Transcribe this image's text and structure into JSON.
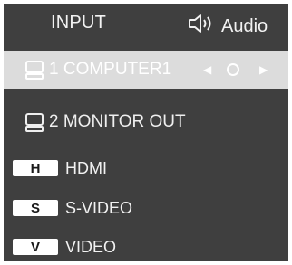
{
  "header": {
    "title": "INPUT",
    "audio_label": "Audio"
  },
  "inputs": [
    {
      "label": "1 COMPUTER1",
      "selected": true,
      "icon": "computer-icon"
    },
    {
      "label": "2 MONITOR OUT",
      "selected": false,
      "icon": "computer-icon"
    }
  ],
  "selector": {
    "left": "◀",
    "right": "▶"
  },
  "sources": [
    {
      "badge": "H",
      "label": "HDMI"
    },
    {
      "badge": "S",
      "label": "S-VIDEO"
    },
    {
      "badge": "V",
      "label": "VIDEO"
    }
  ],
  "colors": {
    "panel": "#3f3f3f",
    "selected_row": "#dcdcdc",
    "text": "#f2f2f2"
  }
}
